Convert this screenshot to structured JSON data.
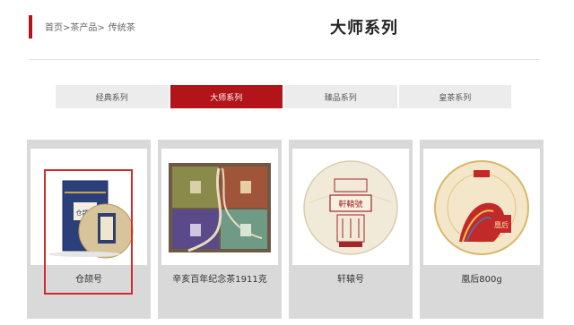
{
  "breadcrumb": {
    "home": "首页>",
    "category": "茶产品>",
    "current": "传统茶"
  },
  "page_title": "大师系列",
  "tabs": [
    {
      "label": "经典系列",
      "active": false
    },
    {
      "label": "大师系列",
      "active": true
    },
    {
      "label": "臻品系列",
      "active": false
    },
    {
      "label": "皇茶系列",
      "active": false
    }
  ],
  "products": [
    {
      "name": "仓颉号",
      "selected": true
    },
    {
      "name": "辛亥百年纪念茶1911克",
      "selected": false
    },
    {
      "name": "轩辕号",
      "selected": false
    },
    {
      "name": "凰后800g",
      "selected": false
    }
  ],
  "product_image_text": {
    "cangjie_box": "仓頡號",
    "xuanyuan_wrapper": "軒轅號",
    "huanghou_label": "凰后"
  },
  "colors": {
    "accent": "#b3141a",
    "tab_bg": "#ececec",
    "card_bg": "#d9d9d9",
    "selection": "#d22a2a"
  }
}
